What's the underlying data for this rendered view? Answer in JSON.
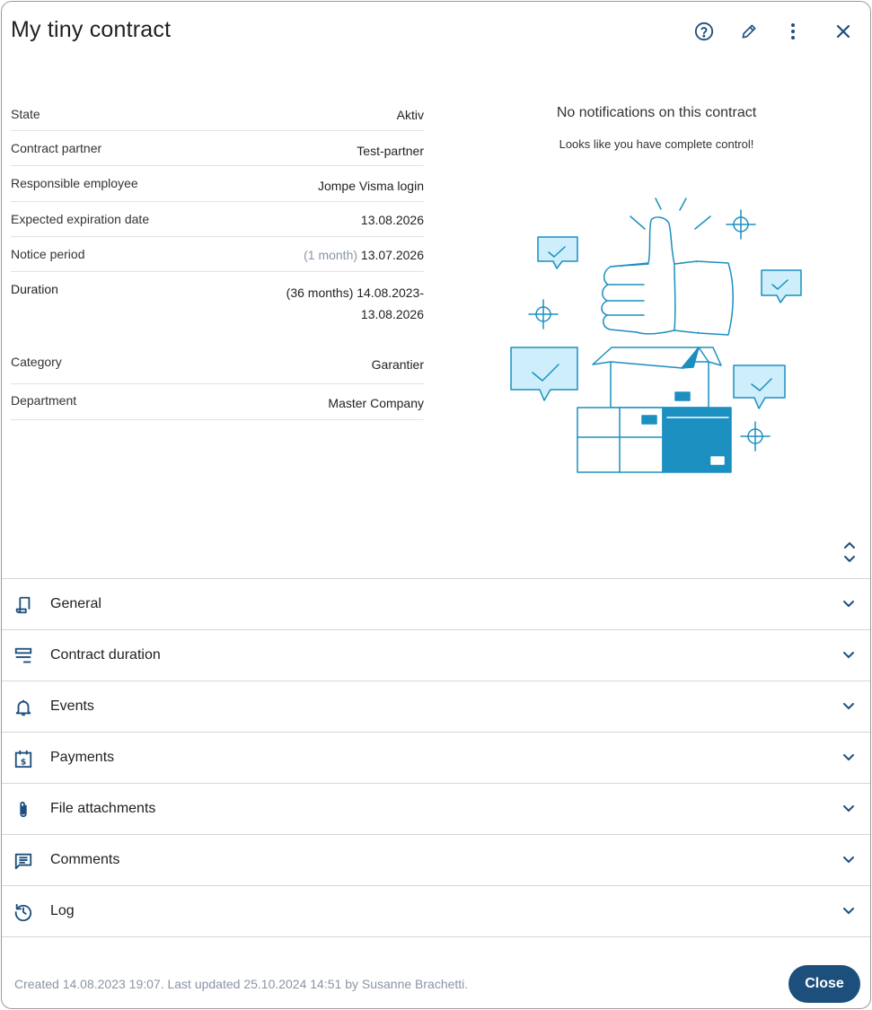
{
  "dialog": {
    "title": "My tiny contract",
    "icons": [
      "help-circle-icon",
      "pencil-icon",
      "more-vertical-icon",
      "close-icon"
    ]
  },
  "details": [
    {
      "label": "State",
      "value": "Aktiv",
      "style": "green"
    },
    {
      "label": "Contract partner",
      "value": "Test-partner",
      "style": "link"
    },
    {
      "label": "Responsible employee",
      "value": "Jompe Visma login",
      "style": "link"
    },
    {
      "label": "Expected expiration date",
      "value": "13.08.2026",
      "style": "plain"
    },
    {
      "label": "Notice period",
      "muted": "(1 month)",
      "value": "13.07.2026",
      "style": "plain"
    },
    {
      "label": "Duration",
      "muted": "(36 months)",
      "value": "14.08.2023-",
      "value2": "13.08.2026",
      "style": "plain"
    },
    {
      "label": "Category",
      "value": "Garantier",
      "style": "plain"
    },
    {
      "label": "Department",
      "value": "Master Company",
      "style": "link"
    }
  ],
  "notifications": {
    "heading": "No notifications on this contract",
    "subtext": "Looks like you have complete control!"
  },
  "sections": [
    {
      "label": "General",
      "icon": "contract-scroll-icon"
    },
    {
      "label": "Contract duration",
      "icon": "duration-lines-icon"
    },
    {
      "label": "Events",
      "icon": "bell-icon"
    },
    {
      "label": "Payments",
      "icon": "calendar-dollar-icon"
    },
    {
      "label": "File attachments",
      "icon": "paperclip-icon"
    },
    {
      "label": "Comments",
      "icon": "comment-icon"
    },
    {
      "label": "Log",
      "icon": "history-icon"
    }
  ],
  "footer": {
    "info": "Created 14.08.2023 19:07. Last updated 25.10.2024 14:51 by Susanne Brachetti.",
    "close_label": "Close"
  },
  "colors": {
    "accent": "#1d4f7c",
    "link": "#1f78c8",
    "status_active": "#2aa33a",
    "illustration": "#1b8fc0",
    "illustration_fill": "#cdeefa"
  }
}
